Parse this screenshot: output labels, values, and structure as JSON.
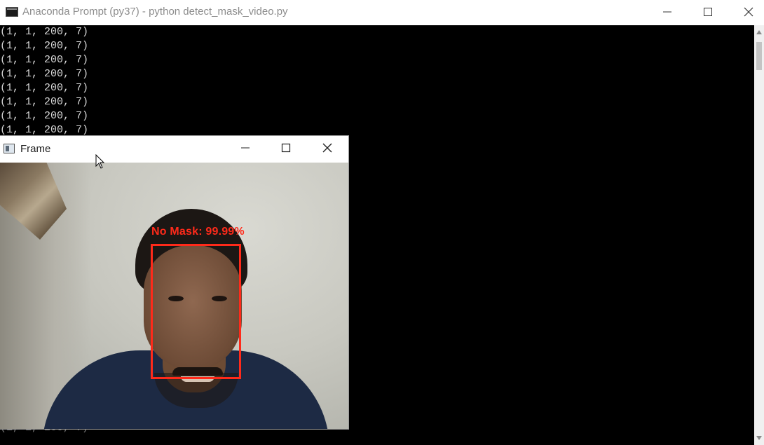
{
  "console": {
    "title": "Anaconda Prompt (py37) - python  detect_mask_video.py",
    "lines": [
      "(1, 1, 200, 7)",
      "(1, 1, 200, 7)",
      "(1, 1, 200, 7)",
      "(1, 1, 200, 7)",
      "(1, 1, 200, 7)",
      "(1, 1, 200, 7)",
      "(1, 1, 200, 7)",
      "(1, 1, 200, 7)",
      "(1, 1, 200, 7)"
    ],
    "background_color": "#000000",
    "text_color": "#d8d8d8"
  },
  "frame_window": {
    "title": "Frame",
    "detection": {
      "label": "No Mask: 99.99%",
      "color": "#ff2a1a"
    }
  },
  "icons": {
    "console_app": "terminal-icon",
    "frame_app": "opencv-window-icon",
    "minimize": "minimize-icon",
    "maximize": "maximize-icon",
    "close": "close-icon",
    "cursor": "mouse-pointer-icon"
  }
}
